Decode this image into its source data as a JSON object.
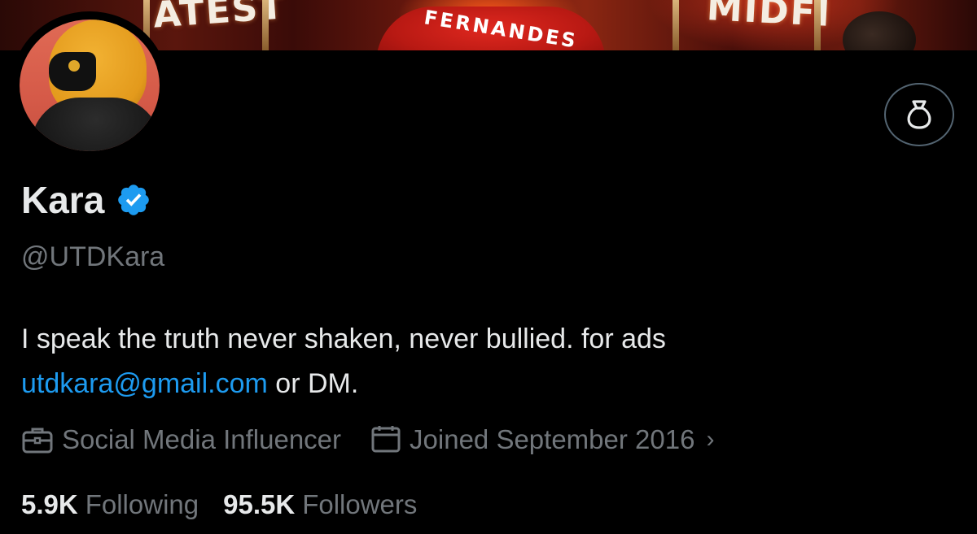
{
  "banner": {
    "left_text": "ATEST",
    "jersey_text": "FERNANDES",
    "right_text": "MIDFI"
  },
  "profile": {
    "display_name": "Kara",
    "handle": "@UTDKara",
    "bio_text": "I speak the truth never shaken, never bullied. for ads",
    "bio_email": "utdkara@gmail.com",
    "bio_suffix": " or DM.",
    "category": "Social Media Influencer",
    "joined": "Joined September 2016",
    "following_count": "5.9K",
    "following_label": "Following",
    "followers_count": "95.5K",
    "followers_label": "Followers"
  },
  "icons": {
    "verified": "verified-badge-icon",
    "action": "money-bag-icon",
    "category": "briefcase-icon",
    "joined": "calendar-icon",
    "chevron": "chevron-right-icon"
  },
  "colors": {
    "background": "#000000",
    "text": "#e7e9ea",
    "muted": "#71767b",
    "link": "#1d9bf0",
    "verified": "#1d9bf0"
  }
}
